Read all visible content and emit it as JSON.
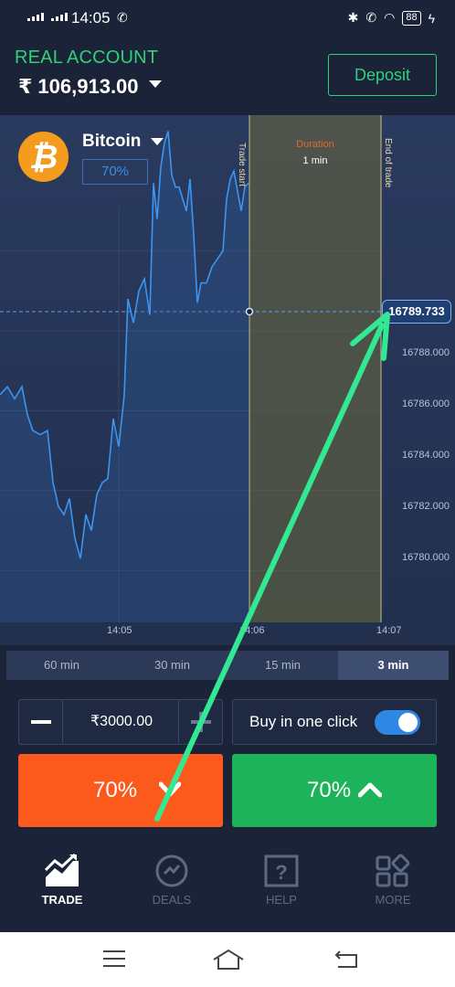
{
  "status_bar": {
    "time": "14:05",
    "battery": "88"
  },
  "account": {
    "label": "REAL ACCOUNT",
    "balance": "₹ 106,913.00",
    "deposit_label": "Deposit"
  },
  "asset": {
    "name": "Bitcoin",
    "payout": "70%",
    "icon": "bitcoin-icon"
  },
  "chart": {
    "current_price": "16789.733",
    "y_ticks": [
      "16788.000",
      "16786.000",
      "16784.000",
      "16782.000",
      "16780.000"
    ],
    "x_ticks": [
      "14:05",
      "14:06",
      "14:07"
    ],
    "trade_start_label": "Trade start",
    "end_of_trade_label": "End of trade",
    "duration_label": "Duration",
    "duration_value": "1 min",
    "colors": {
      "line": "#3b95f0",
      "duration_zone": "#6b6a3d",
      "accent_green": "#2fd07a"
    }
  },
  "chart_data": {
    "type": "line",
    "title": "",
    "xlabel": "",
    "ylabel": "",
    "x_ticks": [
      "14:05",
      "14:06",
      "14:07"
    ],
    "ylim": [
      16778.7,
      16791.4
    ],
    "series": [
      {
        "points": [
          [
            0,
            16784.4
          ],
          [
            8,
            16784.6
          ],
          [
            16,
            16784.3
          ],
          [
            24,
            16784.6
          ],
          [
            30,
            16783.9
          ],
          [
            36,
            16783.5
          ],
          [
            44,
            16783.4
          ],
          [
            52,
            16783.5
          ],
          [
            58,
            16782.2
          ],
          [
            64,
            16781.6
          ],
          [
            70,
            16781.4
          ],
          [
            76,
            16781.8
          ],
          [
            82,
            16780.8
          ],
          [
            88,
            16780.3
          ],
          [
            94,
            16781.4
          ],
          [
            100,
            16781.0
          ],
          [
            106,
            16781.9
          ],
          [
            112,
            16782.2
          ],
          [
            118,
            16782.3
          ],
          [
            124,
            16783.8
          ],
          [
            130,
            16783.1
          ],
          [
            136,
            16784.4
          ],
          [
            140,
            16786.8
          ],
          [
            146,
            16786.2
          ],
          [
            152,
            16787.0
          ],
          [
            158,
            16787.3
          ],
          [
            164,
            16786.4
          ],
          [
            168,
            16789.7
          ],
          [
            172,
            16788.8
          ],
          [
            176,
            16790.1
          ],
          [
            180,
            16790.7
          ],
          [
            184,
            16791.0
          ],
          [
            188,
            16789.9
          ],
          [
            192,
            16789.6
          ],
          [
            196,
            16789.6
          ],
          [
            200,
            16789.3
          ],
          [
            204,
            16789.0
          ],
          [
            208,
            16789.8
          ],
          [
            212,
            16788.4
          ],
          [
            216,
            16786.7
          ],
          [
            220,
            16787.2
          ],
          [
            226,
            16787.2
          ],
          [
            232,
            16787.6
          ],
          [
            238,
            16787.8
          ],
          [
            244,
            16788.0
          ],
          [
            248,
            16789.3
          ],
          [
            252,
            16789.8
          ],
          [
            256,
            16790.0
          ],
          [
            260,
            16789.5
          ],
          [
            264,
            16789.0
          ],
          [
            268,
            16789.6
          ],
          [
            272,
            16789.7
          ]
        ]
      }
    ],
    "grid": true
  },
  "timeframes": [
    {
      "label": "60 min",
      "active": false
    },
    {
      "label": "30 min",
      "active": false
    },
    {
      "label": "15 min",
      "active": false
    },
    {
      "label": "3 min",
      "active": true
    }
  ],
  "trade": {
    "amount": "₹3000.00",
    "one_click_label": "Buy in one click",
    "down_label": "70%",
    "up_label": "70%"
  },
  "nav": {
    "trade": "TRADE",
    "deals": "DEALS",
    "help": "HELP",
    "more": "MORE"
  }
}
